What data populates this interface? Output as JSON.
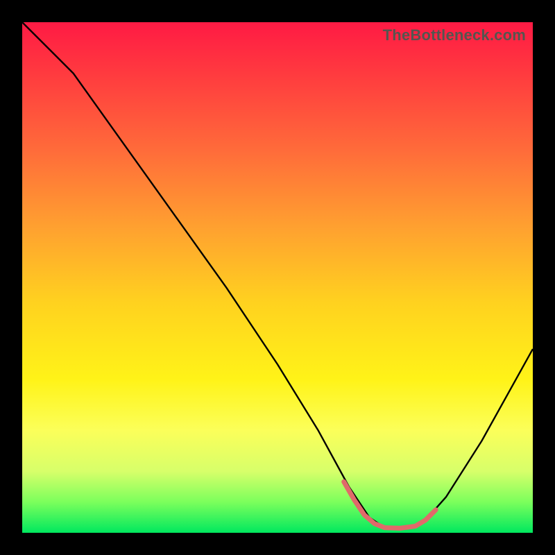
{
  "chart_data": {
    "type": "line",
    "watermark": "TheBottleneck.com",
    "title": "",
    "xlabel": "",
    "ylabel": "",
    "xlim": [
      0,
      100
    ],
    "ylim": [
      0,
      100
    ],
    "series": [
      {
        "name": "bottleneck-curve",
        "color": "#000000",
        "width": 2.4,
        "points": [
          {
            "x": 0,
            "y": 100
          },
          {
            "x": 6,
            "y": 94
          },
          {
            "x": 10,
            "y": 90
          },
          {
            "x": 20,
            "y": 76
          },
          {
            "x": 30,
            "y": 62
          },
          {
            "x": 40,
            "y": 48
          },
          {
            "x": 50,
            "y": 33
          },
          {
            "x": 58,
            "y": 20
          },
          {
            "x": 64,
            "y": 9
          },
          {
            "x": 68,
            "y": 3
          },
          {
            "x": 71,
            "y": 1
          },
          {
            "x": 76,
            "y": 1
          },
          {
            "x": 79,
            "y": 2.5
          },
          {
            "x": 83,
            "y": 7
          },
          {
            "x": 90,
            "y": 18
          },
          {
            "x": 95,
            "y": 27
          },
          {
            "x": 100,
            "y": 36
          }
        ]
      },
      {
        "name": "sweet-spot-highlight",
        "color": "#e06a6a",
        "width": 7,
        "linecap": "round",
        "points": [
          {
            "x": 63,
            "y": 10
          },
          {
            "x": 65,
            "y": 6.5
          },
          {
            "x": 67,
            "y": 3.5
          },
          {
            "x": 69,
            "y": 1.8
          },
          {
            "x": 71,
            "y": 1
          },
          {
            "x": 74,
            "y": 0.9
          },
          {
            "x": 77,
            "y": 1.3
          },
          {
            "x": 79,
            "y": 2.5
          },
          {
            "x": 81,
            "y": 4.5
          }
        ]
      }
    ]
  }
}
